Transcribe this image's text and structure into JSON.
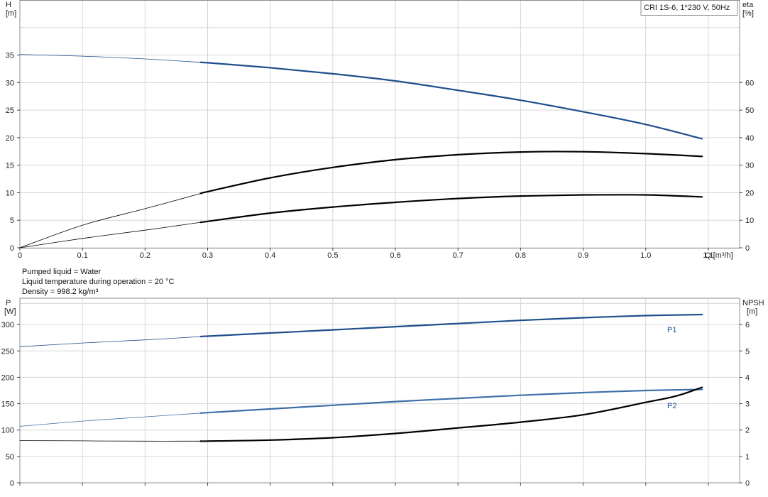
{
  "legend": {
    "text": "CRI 1S-6, 1*230 V, 50Hz"
  },
  "info": [
    "Pumped liquid = Water",
    "Liquid temperature during operation = 20 °C",
    "Density = 998.2 kg/m³"
  ],
  "colors": {
    "blue": "#1f4e8c",
    "lightblue": "#3d6fa8",
    "black": "#000000",
    "grid": "#d6d6d6"
  },
  "chart_data": [
    {
      "type": "line",
      "title": "",
      "xlabel": "Q [m³/h]",
      "ylabel_left": [
        "H",
        "[m]"
      ],
      "ylabel_right": [
        "eta",
        "[%]"
      ],
      "xlim": [
        0,
        1.15
      ],
      "ylim_left": [
        0,
        45
      ],
      "ylim_right": [
        0,
        90
      ],
      "x_ticks": [
        0,
        0.1,
        0.2,
        0.3,
        0.4,
        0.5,
        0.6,
        0.7,
        0.8,
        0.9,
        1.0,
        1.1
      ],
      "x_tick_labels": [
        "0",
        "0.1",
        "0.2",
        "0.3",
        "0.4",
        "0.5",
        "0.6",
        "0.7",
        "0.8",
        "0.9",
        "1.0",
        "1.1"
      ],
      "y_ticks_left": [
        0,
        5,
        10,
        15,
        20,
        25,
        30,
        35
      ],
      "y_ticks_right": [
        0,
        10,
        20,
        30,
        40,
        50,
        60
      ],
      "grid": true,
      "legend_position": "top-right",
      "series": [
        {
          "axis": "left",
          "color": "blue",
          "x": [
            0,
            0.1,
            0.2,
            0.3,
            0.4,
            0.5,
            0.6,
            0.7,
            0.8,
            0.9,
            1.0,
            1.09
          ],
          "y": [
            35.1,
            34.8,
            34.3,
            33.6,
            32.7,
            31.6,
            30.3,
            28.6,
            26.8,
            24.7,
            22.4,
            19.8
          ]
        },
        {
          "axis": "right",
          "color": "black",
          "x": [
            0,
            0.1,
            0.2,
            0.3,
            0.4,
            0.5,
            0.6,
            0.7,
            0.8,
            0.9,
            1.0,
            1.09
          ],
          "y": [
            0,
            8.2,
            14.2,
            20.4,
            25.4,
            29.2,
            32,
            33.8,
            34.8,
            34.9,
            34.2,
            33.2
          ]
        },
        {
          "axis": "right",
          "color": "black",
          "x": [
            0,
            0.1,
            0.2,
            0.3,
            0.4,
            0.5,
            0.6,
            0.7,
            0.8,
            0.9,
            1.0,
            1.09
          ],
          "y": [
            0,
            3.4,
            6.4,
            9.6,
            12.6,
            14.8,
            16.5,
            17.9,
            18.8,
            19.2,
            19.2,
            18.5
          ]
        }
      ]
    },
    {
      "type": "line",
      "title": "",
      "ylabel_left": [
        "P",
        "[W]"
      ],
      "ylabel_right": [
        "NPSH",
        "[m]"
      ],
      "xlim": [
        0,
        1.15
      ],
      "ylim_left": [
        0,
        350
      ],
      "ylim_right": [
        0,
        7
      ],
      "x_ticks": [
        0,
        0.1,
        0.2,
        0.3,
        0.4,
        0.5,
        0.6,
        0.7,
        0.8,
        0.9,
        1.0,
        1.1
      ],
      "y_ticks_left": [
        0,
        50,
        100,
        150,
        200,
        250,
        300
      ],
      "y_ticks_right": [
        0,
        1,
        2,
        3,
        4,
        5,
        6
      ],
      "grid": true,
      "series": [
        {
          "name": "P1",
          "axis": "left",
          "color": "blue",
          "x": [
            0,
            0.1,
            0.2,
            0.3,
            0.4,
            0.5,
            0.6,
            0.7,
            0.8,
            0.9,
            1.0,
            1.09
          ],
          "y": [
            258,
            265,
            271,
            278,
            284,
            290,
            296,
            302,
            308,
            313,
            317,
            319
          ]
        },
        {
          "name": "P2",
          "axis": "left",
          "color": "lightblue",
          "x": [
            0,
            0.1,
            0.2,
            0.3,
            0.4,
            0.5,
            0.6,
            0.7,
            0.8,
            0.9,
            1.0,
            1.09
          ],
          "y": [
            107,
            117,
            125,
            133,
            140,
            147,
            154,
            160,
            166,
            171,
            175,
            177
          ]
        },
        {
          "axis": "right",
          "color": "black",
          "x": [
            0,
            0.1,
            0.2,
            0.3,
            0.4,
            0.5,
            0.6,
            0.7,
            0.8,
            0.9,
            1.0,
            1.05,
            1.09
          ],
          "y": [
            1.6,
            1.59,
            1.58,
            1.58,
            1.62,
            1.71,
            1.87,
            2.08,
            2.3,
            2.58,
            3.05,
            3.3,
            3.62
          ]
        }
      ]
    }
  ]
}
